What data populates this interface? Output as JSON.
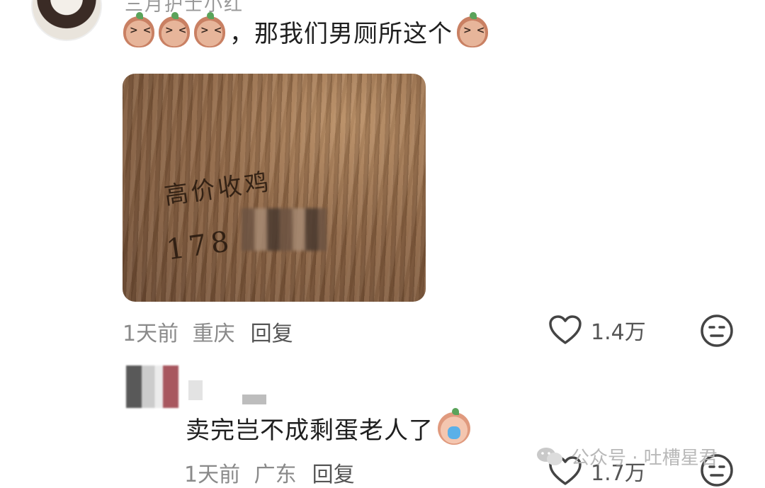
{
  "comment1": {
    "username": "三月护士小红",
    "text": "，那我们男厕所这个",
    "time": "1天前",
    "location": "重庆",
    "reply_label": "回复",
    "likes": "1.4万",
    "photo_text_line1": "高价收鸡",
    "photo_text_line2": "178"
  },
  "comment2": {
    "text": "卖完岂不成剩蛋老人了",
    "time": "1天前",
    "location": "广东",
    "reply_label": "回复",
    "likes": "1.7万"
  },
  "watermark": {
    "text": "公众号 · 吐槽星君"
  },
  "icons": {
    "like": "heart-icon",
    "dislike": "meh-face-icon",
    "watermark": "wechat-icon",
    "emoji": "bean-emoji-icon"
  }
}
